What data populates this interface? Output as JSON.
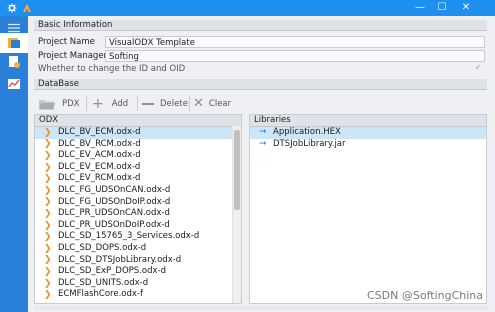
{
  "window": {
    "minimize": "—",
    "maximize": "☐",
    "close": "✕"
  },
  "sidebar": {
    "items": [
      {
        "icon": "menu-icon"
      },
      {
        "icon": "project-icon"
      },
      {
        "icon": "settings-document-icon"
      },
      {
        "icon": "chart-icon"
      }
    ]
  },
  "basic_info": {
    "header": "Basic Information",
    "project_name_label": "Project Name",
    "project_name_value": "VisualODX Template",
    "project_manager_label": "Project Manager",
    "project_manager_value": "Softing",
    "change_id_label": "Whether to change the ID and OID"
  },
  "database": {
    "header": "DataBase",
    "toolbar": {
      "pdx": "PDX",
      "add": "Add",
      "delete": "Delete",
      "clear": "Clear"
    }
  },
  "odx": {
    "header": "ODX",
    "items": [
      "DLC_BV_ECM.odx-d",
      "DLC_BV_RCM.odx-d",
      "DLC_EV_ACM.odx-d",
      "DLC_EV_ECM.odx-d",
      "DLC_EV_RCM.odx-d",
      "DLC_FG_UDSOnCAN.odx-d",
      "DLC_FG_UDSOnDoIP.odx-d",
      "DLC_PR_UDSOnCAN.odx-d",
      "DLC_PR_UDSOnDoIP.odx-d",
      "DLC_SD_15765_3_Services.odx-d",
      "DLC_SD_DOPS.odx-d",
      "DLC_SD_DTSJobLibrary.odx-d",
      "DLC_SD_ExP_DOPS.odx-d",
      "DLC_SD_UNITS.odx-d",
      "ECMFlashCore.odx-f"
    ]
  },
  "libraries": {
    "header": "Libraries",
    "items": [
      "Application.HEX",
      "DTSJobLibrary.jar"
    ]
  },
  "watermark": "CSDN @SoftingChina",
  "colors": {
    "titlebar": "#1e90f0",
    "sidebar": "#2a7fd8",
    "selection": "#cde6f7",
    "chevron": "#e8902a"
  }
}
